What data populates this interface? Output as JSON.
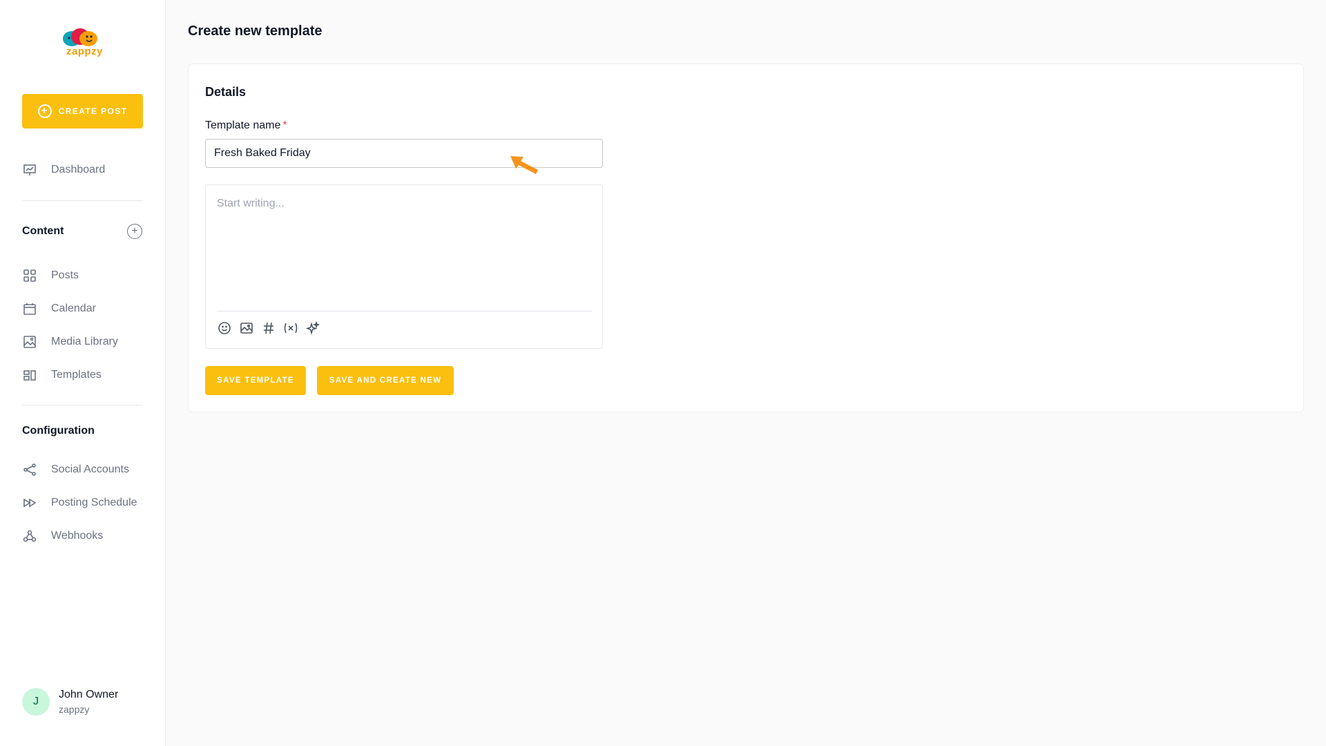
{
  "brand": {
    "name": "zappzy",
    "accent": "#fbbf0f"
  },
  "sidebar": {
    "create_post_label": "CREATE POST",
    "dashboard_label": "Dashboard",
    "content_title": "Content",
    "content_items": [
      {
        "label": "Posts",
        "icon": "grid-icon"
      },
      {
        "label": "Calendar",
        "icon": "calendar-icon"
      },
      {
        "label": "Media Library",
        "icon": "image-icon"
      },
      {
        "label": "Templates",
        "icon": "templates-icon"
      }
    ],
    "configuration_title": "Configuration",
    "configuration_items": [
      {
        "label": "Social Accounts",
        "icon": "share-icon"
      },
      {
        "label": "Posting Schedule",
        "icon": "fast-forward-icon"
      },
      {
        "label": "Webhooks",
        "icon": "webhook-icon"
      }
    ],
    "user": {
      "initial": "J",
      "name": "John Owner",
      "org": "zappzy"
    }
  },
  "main": {
    "page_title": "Create new template",
    "card_title": "Details",
    "field_label": "Template name",
    "required_mark": "*",
    "template_name_value": "Fresh Baked Friday",
    "editor_placeholder": "Start writing...",
    "save_template_label": "SAVE TEMPLATE",
    "save_and_create_new_label": "SAVE AND CREATE NEW"
  }
}
